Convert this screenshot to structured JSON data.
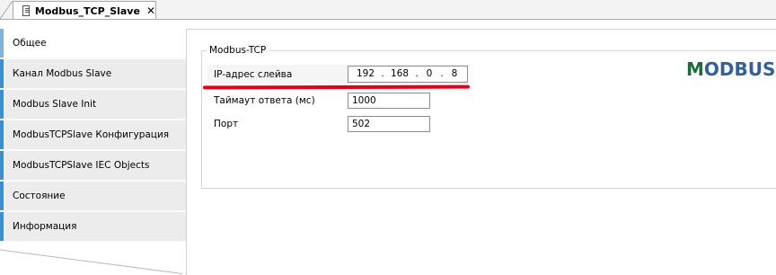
{
  "tab": {
    "title": "Modbus_TCP_Slave",
    "close": "✕"
  },
  "sidebar": {
    "items": [
      {
        "label": "Общее",
        "active": true
      },
      {
        "label": "Канал Modbus Slave"
      },
      {
        "label": "Modbus Slave Init"
      },
      {
        "label": "ModbusTCPSlave Конфигурация"
      },
      {
        "label": "ModbusTCPSlave IEC Objects"
      },
      {
        "label": "Состояние"
      },
      {
        "label": "Информация"
      }
    ]
  },
  "group": {
    "title": "Modbus-TCP",
    "ip": {
      "label": "IP-адрес слейва",
      "octets": [
        "192",
        "168",
        "0",
        "8"
      ],
      "separator": "."
    },
    "timeout": {
      "label": "Таймаут ответа (мс)",
      "value": "1000"
    },
    "port": {
      "label": "Порт",
      "value": "502"
    }
  },
  "logo": {
    "text_first": "M",
    "text_rest": "ODBUS"
  },
  "colors": {
    "accent_bar": "#3a8fd0",
    "underline": "#e3001b",
    "logo_green": "#1b6b3a",
    "logo_blue": "#31609c"
  },
  "icons": {
    "tab_icon": "document-icon",
    "close": "close-icon"
  }
}
